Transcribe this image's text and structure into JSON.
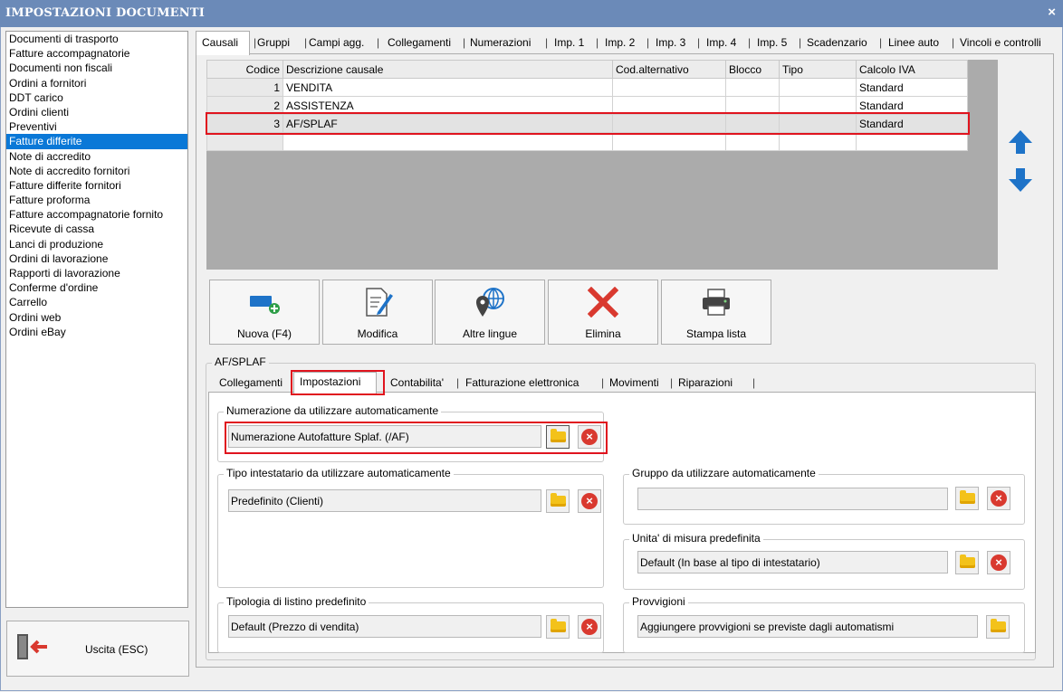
{
  "window": {
    "title": "IMPOSTAZIONI DOCUMENTI",
    "close": "×"
  },
  "left_list": [
    "Documenti di trasporto",
    "Fatture accompagnatorie",
    "Documenti non fiscali",
    "Ordini a fornitori",
    "DDT carico",
    "Ordini clienti",
    "Preventivi",
    "Fatture differite",
    "Note di accredito",
    "Note di accredito fornitori",
    "Fatture differite fornitori",
    "Fatture proforma",
    "Fatture accompagnatorie fornito",
    "Ricevute di cassa",
    "Lanci di produzione",
    "Ordini di lavorazione",
    "Rapporti di lavorazione",
    "Conferme d'ordine",
    "Carrello",
    "Ordini web",
    "Ordini eBay"
  ],
  "left_selected": "Fatture differite",
  "exit_button": "Uscita (ESC)",
  "main_tabs": [
    "Causali",
    "Gruppi",
    "Campi agg.",
    "Collegamenti",
    "Numerazioni",
    "Imp. 1",
    "Imp. 2",
    "Imp. 3",
    "Imp. 4",
    "Imp. 5",
    "Scadenzario",
    "Linee auto",
    "Vincoli e controlli"
  ],
  "main_tab_active": "Causali",
  "grid": {
    "headers": [
      "Codice",
      "Descrizione causale",
      "Cod.alternativo",
      "Blocco",
      "Tipo",
      "Calcolo IVA"
    ],
    "rows": [
      {
        "codice": "1",
        "descrizione": "VENDITA",
        "cod_alt": "",
        "blocco": "",
        "tipo": "",
        "iva": "Standard"
      },
      {
        "codice": "2",
        "descrizione": "ASSISTENZA",
        "cod_alt": "",
        "blocco": "",
        "tipo": "",
        "iva": "Standard"
      },
      {
        "codice": "3",
        "descrizione": "AF/SPLAF",
        "cod_alt": "",
        "blocco": "",
        "tipo": "",
        "iva": "Standard"
      }
    ]
  },
  "toolbar": {
    "nuova": "Nuova (F4)",
    "modifica": "Modifica",
    "altre_lingue": "Altre lingue",
    "elimina": "Elimina",
    "stampa": "Stampa lista"
  },
  "detail_group_title": "AF/SPLAF",
  "sub_tabs": [
    "Collegamenti",
    "Impostazioni",
    "Contabilita'",
    "Fatturazione elettronica",
    "Movimenti",
    "Riparazioni"
  ],
  "sub_tab_active": "Impostazioni",
  "settings": {
    "numerazione": {
      "title": "Numerazione da utilizzare automaticamente",
      "value": "Numerazione Autofatture Splaf. (/AF)"
    },
    "tipo_intestatario": {
      "title": "Tipo intestatario da utilizzare automaticamente",
      "value": "Predefinito (Clienti)"
    },
    "gruppo": {
      "title": "Gruppo da utilizzare automaticamente",
      "value": ""
    },
    "unita_misura": {
      "title": "Unita' di misura predefinita",
      "value": "Default (In base al tipo di intestatario)"
    },
    "listino": {
      "title": "Tipologia di listino predefinito",
      "value": "Default (Prezzo di vendita)"
    },
    "provvigioni": {
      "title": "Provvigioni",
      "value": "Aggiungere provvigioni se previste dagli automatismi"
    }
  },
  "colors": {
    "titlebar": "#6b8ab8",
    "selection": "#0a78d7",
    "highlight": "#e0141e",
    "arrow": "#1e73c8",
    "delete": "#d9392f",
    "folder": "#f3c21a"
  }
}
